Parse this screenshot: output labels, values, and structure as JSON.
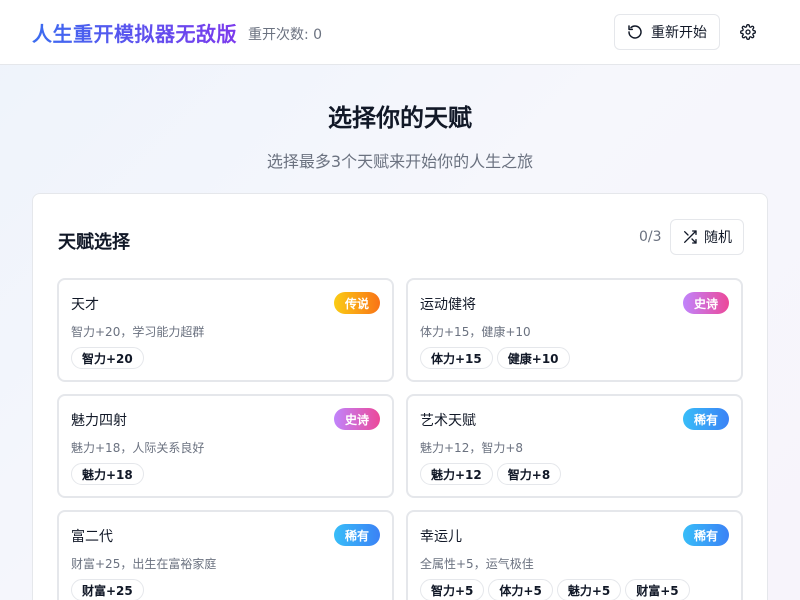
{
  "header": {
    "title": "人生重开模拟器无敌版",
    "restart_count": "重开次数: 0",
    "restart_label": "重新开始",
    "icons": {
      "restart": "rotate-ccw-icon",
      "settings": "gear-icon"
    }
  },
  "hero": {
    "title": "选择你的天赋",
    "subtitle": "选择最多3个天赋来开始你的人生之旅"
  },
  "panel": {
    "title": "天赋选择",
    "count": "0/3",
    "random_label": "随机",
    "icons": {
      "random": "shuffle-icon"
    }
  },
  "talents": [
    {
      "name": "天才",
      "rarity": "传说",
      "rarity_key": "legend",
      "desc": "智力+20，学习能力超群",
      "tags": [
        "智力+20"
      ]
    },
    {
      "name": "运动健将",
      "rarity": "史诗",
      "rarity_key": "epic",
      "desc": "体力+15，健康+10",
      "tags": [
        "体力+15",
        "健康+10"
      ]
    },
    {
      "name": "魅力四射",
      "rarity": "史诗",
      "rarity_key": "epic",
      "desc": "魅力+18，人际关系良好",
      "tags": [
        "魅力+18"
      ]
    },
    {
      "name": "艺术天赋",
      "rarity": "稀有",
      "rarity_key": "rare",
      "desc": "魅力+12，智力+8",
      "tags": [
        "魅力+12",
        "智力+8"
      ]
    },
    {
      "name": "富二代",
      "rarity": "稀有",
      "rarity_key": "rare",
      "desc": "财富+25，出生在富裕家庭",
      "tags": [
        "财富+25"
      ]
    },
    {
      "name": "幸运儿",
      "rarity": "稀有",
      "rarity_key": "rare",
      "desc": "全属性+5，运气极佳",
      "tags": [
        "智力+5",
        "体力+5",
        "魅力+5",
        "财富+5"
      ]
    }
  ],
  "colors": {
    "legend": "#f97316",
    "epic": "#d946ef",
    "rare": "#3b82f6",
    "brand_start": "#3b6cf0",
    "brand_end": "#7c3aed"
  }
}
